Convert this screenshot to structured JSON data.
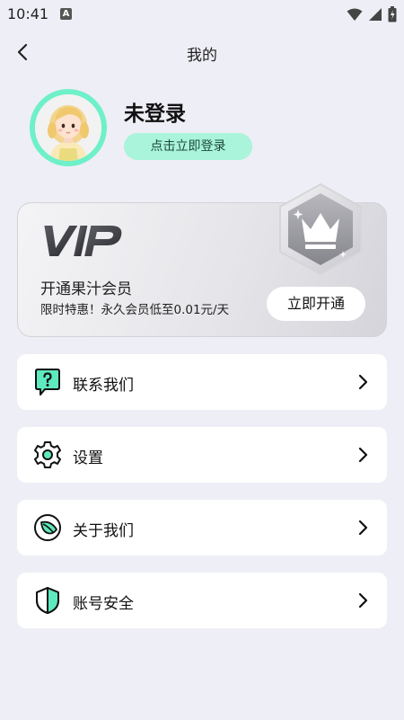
{
  "status_bar": {
    "time": "10:41",
    "notification_badge": "A",
    "icons": [
      "wifi-icon",
      "signal-icon",
      "battery-icon"
    ]
  },
  "header": {
    "title": "我的",
    "back_icon": "chevron-left-icon"
  },
  "profile": {
    "name": "未登录",
    "login_button": "点击立即登录",
    "avatar_border_color": "#6ef0c8"
  },
  "vip": {
    "logo_text": "VIP",
    "title": "开通果汁会员",
    "description": "限时特惠！永久会员低至0.01元/天",
    "open_button": "立即开通",
    "badge_icon": "crown-icon"
  },
  "menu": {
    "items": [
      {
        "label": "联系我们",
        "icon": "chat-question-icon"
      },
      {
        "label": "设置",
        "icon": "gear-icon"
      },
      {
        "label": "关于我们",
        "icon": "leaf-icon"
      },
      {
        "label": "账号安全",
        "icon": "shield-icon"
      }
    ],
    "arrow_icon": "chevron-right-icon"
  },
  "colors": {
    "accent": "#5ee9bf",
    "accent_light": "#a9f4da",
    "background": "#eeeef6"
  }
}
